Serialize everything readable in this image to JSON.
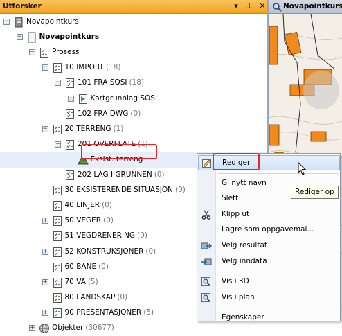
{
  "panel": {
    "title": "Utforsker",
    "header_buttons": [
      "▾",
      "⊥",
      "✕"
    ]
  },
  "tree": [
    {
      "label": "Novapointkurs",
      "count": "",
      "indent": 0,
      "expander": "−",
      "icon": "database-icon",
      "bold": false
    },
    {
      "label": "Novapointkurs",
      "count": "",
      "indent": 1,
      "expander": "−",
      "icon": "project-icon",
      "bold": true
    },
    {
      "label": "Prosess",
      "count": "",
      "indent": 2,
      "expander": "−",
      "icon": "checklist-icon",
      "bold": false
    },
    {
      "label": "10 IMPORT",
      "count": "(18)",
      "indent": 3,
      "expander": "−",
      "icon": "checklist-icon",
      "bold": false
    },
    {
      "label": "101 FRA SOSI",
      "count": "(18)",
      "indent": 4,
      "expander": "−",
      "icon": "checklist-icon",
      "bold": false
    },
    {
      "label": "Kartgrunnlag SOSI",
      "count": "",
      "indent": 5,
      "expander": "+",
      "icon": "map-data-icon",
      "bold": false
    },
    {
      "label": "102 FRA DWG",
      "count": "(0)",
      "indent": 4,
      "expander": "",
      "icon": "checklist-icon",
      "bold": false
    },
    {
      "label": "20 TERRENG",
      "count": "(1)",
      "indent": 3,
      "expander": "−",
      "icon": "checklist-icon",
      "bold": false
    },
    {
      "label": "201 OVERFLATE",
      "count": "(1)",
      "indent": 4,
      "expander": "−",
      "icon": "checklist-icon",
      "bold": false
    },
    {
      "label": "Eksist. terreng",
      "count": "",
      "indent": 5,
      "expander": "",
      "icon": "terrain-icon",
      "bold": false,
      "selected": true
    },
    {
      "label": "202 LAG I GRUNNEN",
      "count": "(0)",
      "indent": 4,
      "expander": "",
      "icon": "checklist-icon",
      "bold": false
    },
    {
      "label": "30 EKSISTERENDE SITUASJON",
      "count": "(0)",
      "indent": 3,
      "expander": "",
      "icon": "checklist-icon",
      "bold": false
    },
    {
      "label": "40 LINJER",
      "count": "(0)",
      "indent": 3,
      "expander": "",
      "icon": "checklist-icon",
      "bold": false
    },
    {
      "label": "50 VEGER",
      "count": "(0)",
      "indent": 3,
      "expander": "+",
      "icon": "checklist-icon",
      "bold": false
    },
    {
      "label": "51 VEGDRENERING",
      "count": "(0)",
      "indent": 3,
      "expander": "",
      "icon": "checklist-icon",
      "bold": false
    },
    {
      "label": "52 KONSTRUKSJONER",
      "count": "(0)",
      "indent": 3,
      "expander": "+",
      "icon": "checklist-icon",
      "bold": false
    },
    {
      "label": "60 BANE",
      "count": "(0)",
      "indent": 3,
      "expander": "",
      "icon": "checklist-icon",
      "bold": false
    },
    {
      "label": "70 VA",
      "count": "(5)",
      "indent": 3,
      "expander": "+",
      "icon": "checklist-icon",
      "bold": false
    },
    {
      "label": "80 LANDSKAP",
      "count": "(0)",
      "indent": 3,
      "expander": "",
      "icon": "checklist-icon",
      "bold": false
    },
    {
      "label": "90 PRESENTASJONER",
      "count": "(5)",
      "indent": 3,
      "expander": "+",
      "icon": "checklist-icon",
      "bold": false
    },
    {
      "label": "Objekter",
      "count": "(30677)",
      "indent": 2,
      "expander": "+",
      "icon": "globe-icon",
      "bold": false
    }
  ],
  "map_tab": {
    "title": "Novapointkurs"
  },
  "context_menu": {
    "items": [
      {
        "label": "Rediger",
        "icon": "edit-icon",
        "hover": true
      },
      {
        "sep": true
      },
      {
        "label": "Gi nytt navn",
        "icon": ""
      },
      {
        "label": "Slett",
        "icon": ""
      },
      {
        "label": "Klipp ut",
        "icon": "scissors-icon"
      },
      {
        "label": "Lagre som oppgavemal...",
        "icon": ""
      },
      {
        "label": "Velg resultat",
        "icon": "select-result-icon"
      },
      {
        "label": "Velg inndata",
        "icon": "select-input-icon"
      },
      {
        "sep": true
      },
      {
        "label": "Vis i 3D",
        "icon": "view-3d-icon"
      },
      {
        "label": "Vis i plan",
        "icon": "view-plan-icon"
      },
      {
        "sep": true
      },
      {
        "label": "Egenskaper",
        "icon": ""
      }
    ]
  },
  "tooltip": "Rediger op",
  "colors": {
    "header": "#f4a31f",
    "highlight": "#e0282f",
    "map_orange": "#f08a1c"
  }
}
